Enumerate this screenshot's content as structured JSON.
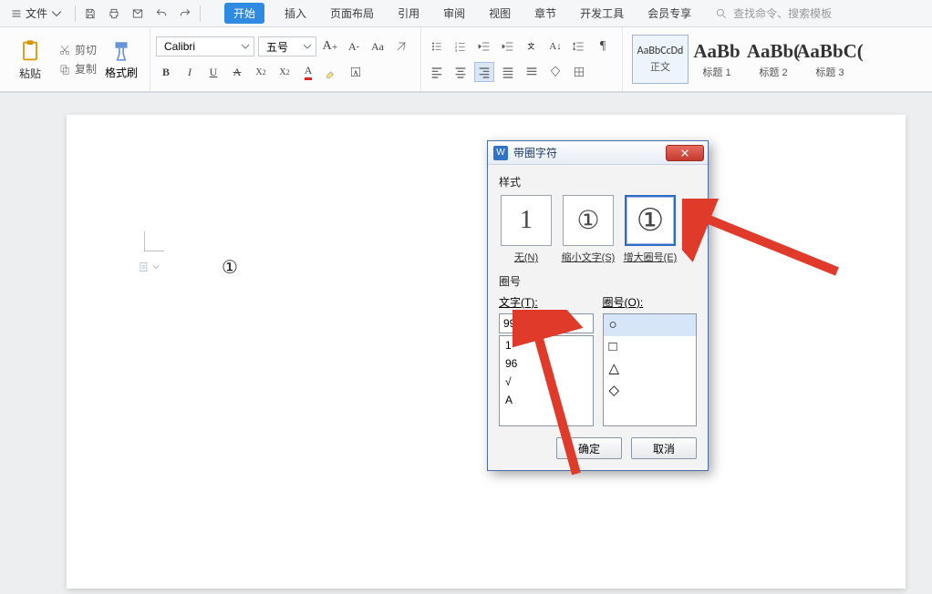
{
  "menu": {
    "file_label": "文件",
    "tabs": [
      "开始",
      "插入",
      "页面布局",
      "引用",
      "审阅",
      "视图",
      "章节",
      "开发工具",
      "会员专享"
    ],
    "active_tab_index": 0,
    "search_placeholder": "查找命令、搜索模板"
  },
  "ribbon": {
    "paste_label": "粘贴",
    "cut_label": "剪切",
    "copy_label": "复制",
    "format_painter_label": "格式刷",
    "font_name": "Calibri",
    "font_size": "五号",
    "styles": [
      {
        "preview": "AaBbCcDd",
        "name": "正文",
        "big": false
      },
      {
        "preview": "AaBb",
        "name": "标题 1",
        "big": true
      },
      {
        "preview": "AaBb(",
        "name": "标题 2",
        "big": true
      },
      {
        "preview": "AaBbC(",
        "name": "标题 3",
        "big": true
      }
    ],
    "active_style_index": 0
  },
  "document": {
    "circled_symbol": "①"
  },
  "dialog": {
    "title": "带圈字符",
    "style_label": "样式",
    "style_options": [
      {
        "glyph": "1",
        "label": "无(N)"
      },
      {
        "glyph": "①",
        "label": "缩小文字(S)"
      },
      {
        "glyph": "①",
        "label": "增大圈号(E)"
      }
    ],
    "active_style_index": 2,
    "enclosure_label_section": "圈号",
    "text_label": "文字(T):",
    "enclosure_label": "圈号(O):",
    "text_value": "99",
    "text_options": [
      "1",
      "96",
      "√",
      "A"
    ],
    "shape_options": [
      "○",
      "□",
      "△",
      "◇"
    ],
    "active_shape_index": 0,
    "ok_label": "确定",
    "cancel_label": "取消"
  }
}
